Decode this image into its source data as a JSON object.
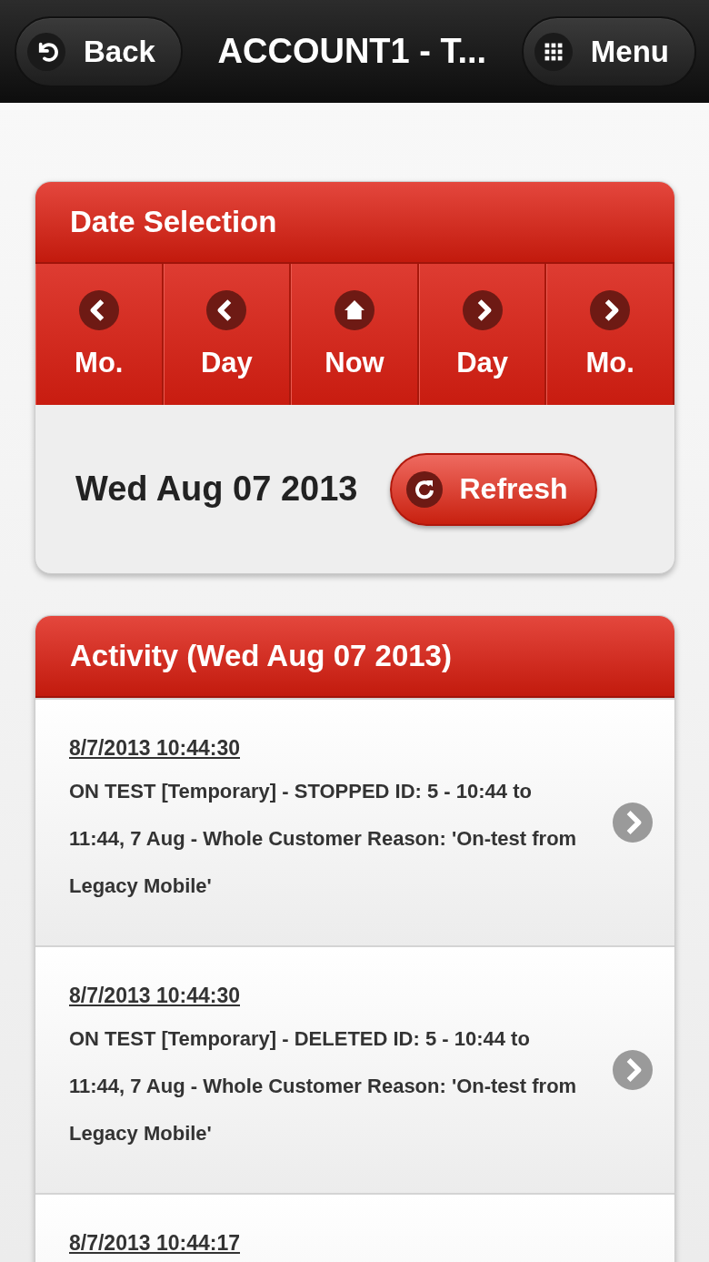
{
  "header": {
    "back": "Back",
    "title": "ACCOUNT1 - T...",
    "menu": "Menu"
  },
  "date_selection": {
    "title": "Date Selection",
    "nav_buttons": [
      {
        "label": "Mo.",
        "kind": "prev"
      },
      {
        "label": "Day",
        "kind": "prev"
      },
      {
        "label": "Now",
        "kind": "home"
      },
      {
        "label": "Day",
        "kind": "next"
      },
      {
        "label": "Mo.",
        "kind": "next"
      }
    ],
    "date": "Wed Aug 07 2013",
    "refresh": "Refresh"
  },
  "activity": {
    "title": "Activity (Wed Aug 07 2013)",
    "items": [
      {
        "time": "8/7/2013 10:44:30",
        "detail": "ON TEST [Temporary] - STOPPED ID: 5 - 10:44 to 11:44, 7 Aug - Whole Customer Reason: 'On-test from Legacy Mobile'"
      },
      {
        "time": "8/7/2013 10:44:30",
        "detail": "ON TEST [Temporary] - DELETED ID: 5 - 10:44 to 11:44, 7 Aug - Whole Customer Reason: 'On-test from Legacy Mobile'"
      },
      {
        "time": "8/7/2013 10:44:17"
      }
    ]
  }
}
